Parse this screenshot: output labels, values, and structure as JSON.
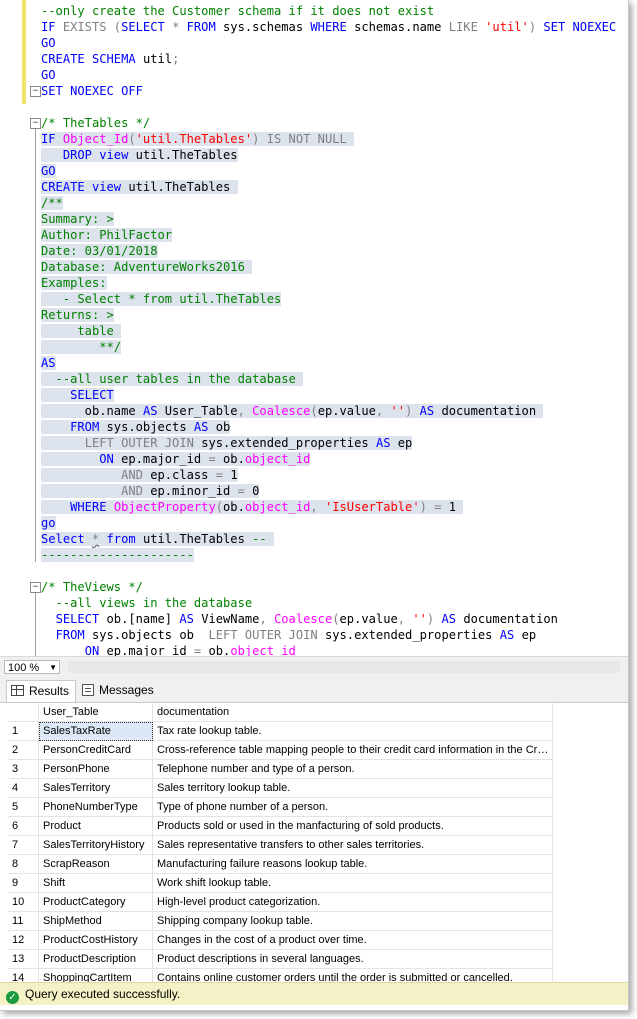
{
  "editor": {
    "lines": [
      [
        [
          "cm",
          "--only create the Customer schema if it does not exist"
        ]
      ],
      [
        [
          "kw",
          "IF "
        ],
        [
          "gr",
          "EXISTS ("
        ],
        [
          "kw",
          "SELECT "
        ],
        [
          "gr",
          "* "
        ],
        [
          "kw",
          "FROM "
        ],
        [
          "",
          "sys.schemas "
        ],
        [
          "kw",
          "WHERE "
        ],
        [
          "",
          "schemas.name "
        ],
        [
          "gr",
          "LIKE "
        ],
        [
          "str",
          "'util'"
        ],
        [
          "gr",
          ") "
        ],
        [
          "kw",
          "SET NOEXEC ON"
        ],
        [
          "gr",
          ";"
        ]
      ],
      [
        [
          "kw",
          "GO"
        ]
      ],
      [
        [
          "kw",
          "CREATE SCHEMA "
        ],
        [
          "",
          "util"
        ],
        [
          "gr",
          ";"
        ]
      ],
      [
        [
          "kw",
          "GO"
        ]
      ],
      [
        [
          "kw",
          "SET NOEXEC OFF"
        ]
      ],
      [],
      [
        [
          "cm",
          "/* TheTables */"
        ]
      ],
      [
        [
          "kw",
          "IF "
        ],
        [
          "fn",
          "Object_Id"
        ],
        [
          "gr",
          "("
        ],
        [
          "str",
          "'util.TheTables'"
        ],
        [
          "gr",
          ") IS NOT NULL "
        ]
      ],
      [
        [
          "",
          "   "
        ],
        [
          "kw",
          "DROP view "
        ],
        [
          "",
          "util.TheTables"
        ]
      ],
      [
        [
          "kw",
          "GO"
        ]
      ],
      [
        [
          "kw",
          "CREATE view "
        ],
        [
          "",
          "util.TheTables "
        ]
      ],
      [
        [
          "cm",
          "/**"
        ]
      ],
      [
        [
          "cm",
          "Summary: >"
        ]
      ],
      [
        [
          "cm",
          "Author: PhilFactor"
        ]
      ],
      [
        [
          "cm",
          "Date: 03/01/2018"
        ]
      ],
      [
        [
          "cm",
          "Database: AdventureWorks2016 "
        ]
      ],
      [
        [
          "cm",
          "Examples:"
        ]
      ],
      [
        [
          "cm",
          "   - Select * from util.TheTables"
        ]
      ],
      [
        [
          "cm",
          "Returns: >"
        ]
      ],
      [
        [
          "cm",
          "     table "
        ]
      ],
      [
        [
          "cm",
          "        **/"
        ]
      ],
      [
        [
          "kw",
          "AS"
        ]
      ],
      [
        [
          "cm",
          "  --all user tables in the database "
        ]
      ],
      [
        [
          "",
          "    "
        ],
        [
          "kw",
          "SELECT"
        ]
      ],
      [
        [
          "",
          "      ob.name "
        ],
        [
          "kw",
          "AS "
        ],
        [
          "",
          "User_Table"
        ],
        [
          "gr",
          ", "
        ],
        [
          "fn",
          "Coalesce"
        ],
        [
          "gr",
          "("
        ],
        [
          "",
          "ep.value"
        ],
        [
          "gr",
          ", "
        ],
        [
          "str",
          "''"
        ],
        [
          "gr",
          ") "
        ],
        [
          "kw",
          "AS "
        ],
        [
          "",
          "documentation "
        ]
      ],
      [
        [
          "",
          "    "
        ],
        [
          "kw",
          "FROM "
        ],
        [
          "",
          "sys.objects "
        ],
        [
          "kw",
          "AS "
        ],
        [
          "",
          "ob"
        ]
      ],
      [
        [
          "",
          "      "
        ],
        [
          "gr",
          "LEFT OUTER JOIN "
        ],
        [
          "",
          "sys.extended_properties "
        ],
        [
          "kw",
          "AS "
        ],
        [
          "",
          "ep"
        ]
      ],
      [
        [
          "",
          "        "
        ],
        [
          "kw",
          "ON "
        ],
        [
          "",
          "ep.major_id "
        ],
        [
          "gr",
          "= "
        ],
        [
          "",
          "ob."
        ],
        [
          "fn",
          "object_id"
        ]
      ],
      [
        [
          "",
          "           "
        ],
        [
          "gr",
          "AND "
        ],
        [
          "",
          "ep.class "
        ],
        [
          "gr",
          "= "
        ],
        [
          "",
          "1"
        ]
      ],
      [
        [
          "",
          "           "
        ],
        [
          "gr",
          "AND "
        ],
        [
          "",
          "ep.minor_id "
        ],
        [
          "gr",
          "= "
        ],
        [
          "",
          "0"
        ]
      ],
      [
        [
          "",
          "    "
        ],
        [
          "kw",
          "WHERE "
        ],
        [
          "fn",
          "ObjectProperty"
        ],
        [
          "gr",
          "("
        ],
        [
          "",
          "ob."
        ],
        [
          "fn",
          "object_id"
        ],
        [
          "gr",
          ", "
        ],
        [
          "str",
          "'IsUserTable'"
        ],
        [
          "gr",
          ") = "
        ],
        [
          "",
          "1 "
        ]
      ],
      [
        [
          "kw",
          "go"
        ]
      ],
      [
        [
          "kw",
          "Select "
        ],
        [
          "sqgr",
          "*"
        ],
        [
          "kw",
          " from "
        ],
        [
          "",
          "util.TheTables "
        ],
        [
          "cm",
          "-- "
        ]
      ],
      [
        [
          "cm",
          "---------------------"
        ]
      ],
      [],
      [
        [
          "cm",
          "/* TheViews */"
        ]
      ],
      [
        [
          "cm",
          "  --all views in the database"
        ]
      ],
      [
        [
          "",
          "  "
        ],
        [
          "kw",
          "SELECT "
        ],
        [
          "",
          "ob.[name] "
        ],
        [
          "kw",
          "AS "
        ],
        [
          "",
          "ViewName"
        ],
        [
          "gr",
          ", "
        ],
        [
          "fn",
          "Coalesce"
        ],
        [
          "gr",
          "("
        ],
        [
          "",
          "ep.value"
        ],
        [
          "gr",
          ", "
        ],
        [
          "str",
          "''"
        ],
        [
          "gr",
          ") "
        ],
        [
          "kw",
          "AS "
        ],
        [
          "",
          "documentation"
        ]
      ],
      [
        [
          "",
          "  "
        ],
        [
          "kw",
          "FROM "
        ],
        [
          "",
          "sys.objects ob  "
        ],
        [
          "gr",
          "LEFT OUTER JOIN "
        ],
        [
          "",
          "sys.extended_properties "
        ],
        [
          "kw",
          "AS "
        ],
        [
          "",
          "ep"
        ]
      ],
      [
        [
          "",
          "      "
        ],
        [
          "kw",
          "ON "
        ],
        [
          "",
          "ep.major_id "
        ],
        [
          "gr",
          "= "
        ],
        [
          "",
          "ob."
        ],
        [
          "fn",
          "object_id"
        ]
      ]
    ]
  },
  "zoom": {
    "value": "100 %"
  },
  "tabs": {
    "results": "Results",
    "messages": "Messages"
  },
  "grid": {
    "headers": [
      "User_Table",
      "documentation"
    ],
    "rows": [
      [
        "1",
        "SalesTaxRate",
        "Tax rate lookup table."
      ],
      [
        "2",
        "PersonCreditCard",
        "Cross-reference table mapping people to their credit card information in the Credit..."
      ],
      [
        "3",
        "PersonPhone",
        "Telephone number and type of a person."
      ],
      [
        "4",
        "SalesTerritory",
        "Sales territory lookup table."
      ],
      [
        "5",
        "PhoneNumberType",
        "Type of phone number of a person."
      ],
      [
        "6",
        "Product",
        "Products sold or used in the manfacturing of sold products."
      ],
      [
        "7",
        "SalesTerritoryHistory",
        "Sales representative transfers to other sales territories."
      ],
      [
        "8",
        "ScrapReason",
        "Manufacturing failure reasons lookup table."
      ],
      [
        "9",
        "Shift",
        "Work shift lookup table."
      ],
      [
        "10",
        "ProductCategory",
        "High-level product categorization."
      ],
      [
        "11",
        "ShipMethod",
        "Shipping company lookup table."
      ],
      [
        "12",
        "ProductCostHistory",
        "Changes in the cost of a product over time."
      ],
      [
        "13",
        "ProductDescription",
        "Product descriptions in several languages."
      ],
      [
        "14",
        "ShoppingCartItem",
        "Contains online customer orders until the order is submitted or cancelled."
      ]
    ]
  },
  "status": {
    "message": "Query executed successfully."
  }
}
